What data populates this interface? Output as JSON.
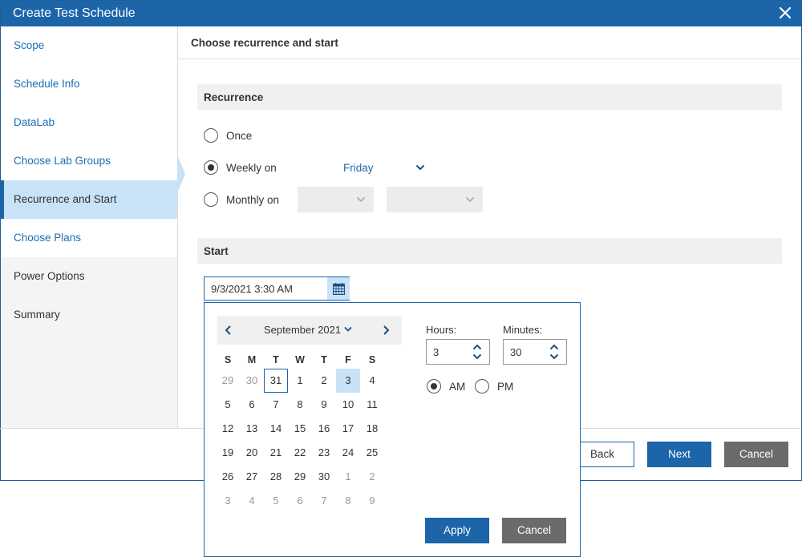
{
  "dialog": {
    "title": "Create Test Schedule"
  },
  "sidebar": {
    "items": [
      {
        "label": "Scope"
      },
      {
        "label": "Schedule Info"
      },
      {
        "label": "DataLab"
      },
      {
        "label": "Choose Lab Groups"
      },
      {
        "label": "Recurrence and Start"
      },
      {
        "label": "Choose Plans"
      },
      {
        "label": "Power Options"
      },
      {
        "label": "Summary"
      }
    ]
  },
  "content": {
    "heading": "Choose recurrence and start"
  },
  "recurrence": {
    "section_title": "Recurrence",
    "once_label": "Once",
    "weekly_label": "Weekly on",
    "weekly_day": "Friday",
    "monthly_label": "Monthly on",
    "selected": "weekly"
  },
  "start": {
    "section_title": "Start",
    "value": "9/3/2021 3:30 AM"
  },
  "calendar": {
    "month_label": "September 2021",
    "weekdays": [
      "S",
      "M",
      "T",
      "W",
      "T",
      "F",
      "S"
    ],
    "weeks": [
      [
        "29",
        "30",
        "31",
        "1",
        "2",
        "3",
        "4"
      ],
      [
        "5",
        "6",
        "7",
        "8",
        "9",
        "10",
        "11"
      ],
      [
        "12",
        "13",
        "14",
        "15",
        "16",
        "17",
        "18"
      ],
      [
        "19",
        "20",
        "21",
        "22",
        "23",
        "24",
        "25"
      ],
      [
        "26",
        "27",
        "28",
        "29",
        "30",
        "1",
        "2"
      ],
      [
        "3",
        "4",
        "5",
        "6",
        "7",
        "8",
        "9"
      ]
    ]
  },
  "time": {
    "hours_label": "Hours:",
    "hours_value": "3",
    "minutes_label": "Minutes:",
    "minutes_value": "30",
    "am_label": "AM",
    "pm_label": "PM",
    "period": "AM"
  },
  "popup_buttons": {
    "apply": "Apply",
    "cancel": "Cancel"
  },
  "footer": {
    "back": "Back",
    "next": "Next",
    "cancel": "Cancel"
  },
  "colors": {
    "accent": "#1c65a8",
    "selected_bg": "#c8e2f7",
    "link": "#1c6eb4"
  }
}
